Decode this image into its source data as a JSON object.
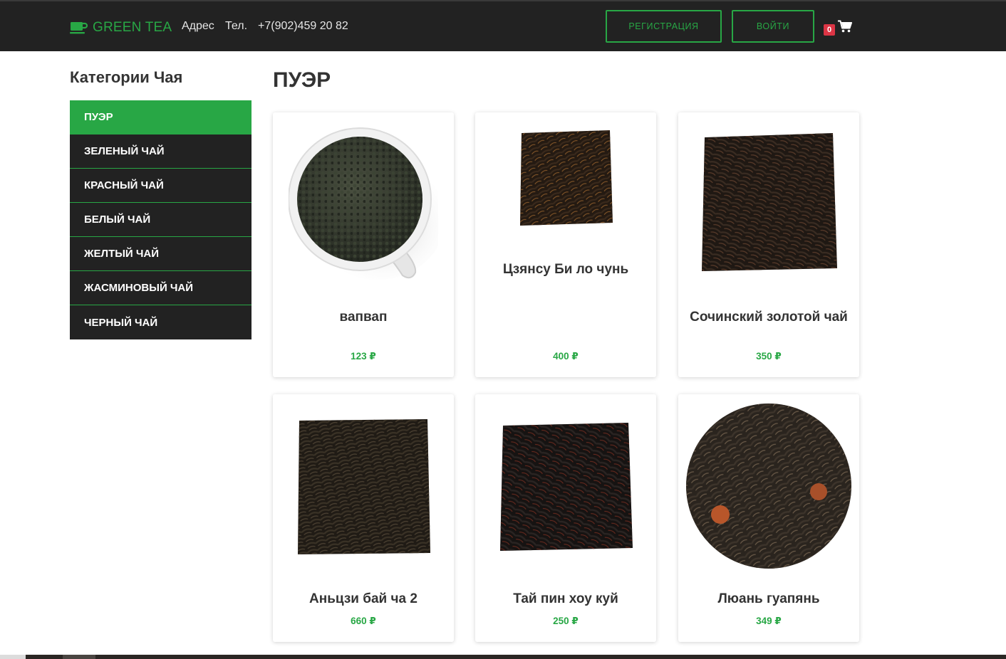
{
  "header": {
    "brand": "GREEN TEA",
    "address_label": "Адрес",
    "phone_label": "Тел.",
    "phone": "+7(902)459 20 82",
    "register_label": "РЕГИСТРАЦИЯ",
    "login_label": "ВОЙТИ",
    "cart_count": "0"
  },
  "sidebar": {
    "title": "Категории Чая",
    "items": [
      {
        "label": "ПУЭР",
        "active": true
      },
      {
        "label": "ЗЕЛЕНЫЙ ЧАЙ",
        "active": false
      },
      {
        "label": "КРАСНЫЙ ЧАЙ",
        "active": false
      },
      {
        "label": "БЕЛЫЙ ЧАЙ",
        "active": false
      },
      {
        "label": "ЖЕЛТЫЙ ЧАЙ",
        "active": false
      },
      {
        "label": "ЖАСМИНОВЫЙ ЧАЙ",
        "active": false
      },
      {
        "label": "ЧЕРНЫЙ ЧАЙ",
        "active": false
      }
    ]
  },
  "main": {
    "title": "ПУЭР",
    "products": [
      {
        "name": "вапвап",
        "price": "123 ₽",
        "image": "tea-cup-image"
      },
      {
        "name": "Цзянсу Би ло чунь",
        "price": "400 ₽",
        "image": "tea-leaves-image"
      },
      {
        "name": "Сочинский золотой чай",
        "price": "350 ₽",
        "image": "tea-leaves-image"
      },
      {
        "name": "Аньцзи бай ча 2",
        "price": "660 ₽",
        "image": "tea-leaves-image"
      },
      {
        "name": "Тай пин хоу куй",
        "price": "250 ₽",
        "image": "tea-leaves-image"
      },
      {
        "name": "Люань гуапянь",
        "price": "349 ₽",
        "image": "tea-leaves-image"
      }
    ]
  },
  "colors": {
    "accent": "#28a745",
    "header_bg": "#222222",
    "badge": "#dc3545"
  }
}
